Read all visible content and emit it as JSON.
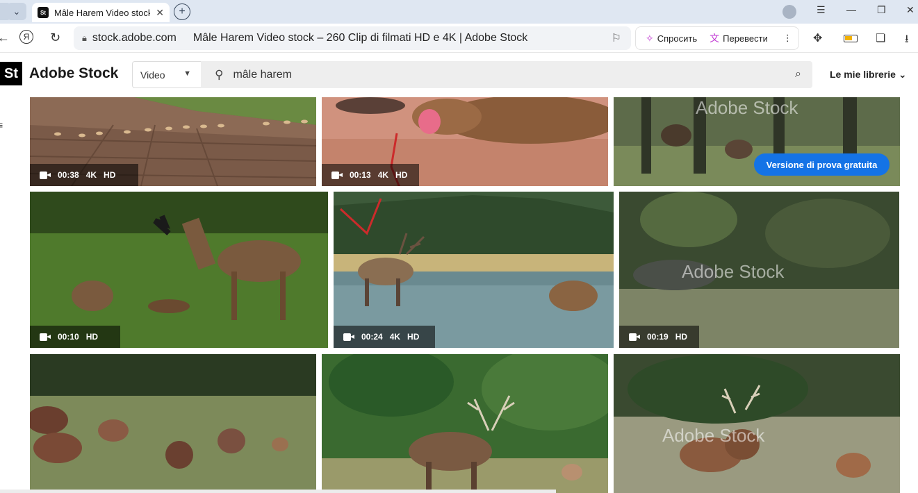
{
  "browser": {
    "tab": {
      "favicon": "St",
      "title": "Mâle Harem Video stock",
      "close_icon": "close-icon"
    },
    "new_tab_icon": "plus-icon",
    "window_controls": [
      "menu-icon",
      "minimize-icon",
      "restore-icon",
      "close-icon"
    ],
    "address": {
      "domain": "stock.adobe.com",
      "page_title": "Mâle Harem Video stock – 260 Clip di filmati HD e 4K | Adobe Stock"
    },
    "ai_buttons": {
      "ask": "Спросить",
      "translate": "Перевести"
    },
    "colors": {
      "tabstrip": "#dfe7f2",
      "ai_accent": "#c23bd4"
    }
  },
  "site": {
    "logo": "St",
    "brand": "Adobe Stock",
    "type_filter": "Video",
    "search_value": "mâle harem",
    "libraries_label": "Le mie librerie",
    "colors": {
      "primary_blue": "#1473e6"
    }
  },
  "results": {
    "trial_button": "Versione di prova gratuita",
    "watermark": "Adobe Stock",
    "tiles": [
      {
        "duration": "00:38",
        "badges": [
          "4K",
          "HD"
        ]
      },
      {
        "duration": "00:13",
        "badges": [
          "4K",
          "HD"
        ]
      },
      {
        "duration": "",
        "badges": []
      },
      {
        "duration": "00:10",
        "badges": [
          "HD"
        ]
      },
      {
        "duration": "00:24",
        "badges": [
          "4K",
          "HD"
        ]
      },
      {
        "duration": "00:19",
        "badges": [
          "HD"
        ]
      },
      {
        "duration": "",
        "badges": []
      },
      {
        "duration": "",
        "badges": []
      },
      {
        "duration": "",
        "badges": []
      }
    ]
  }
}
